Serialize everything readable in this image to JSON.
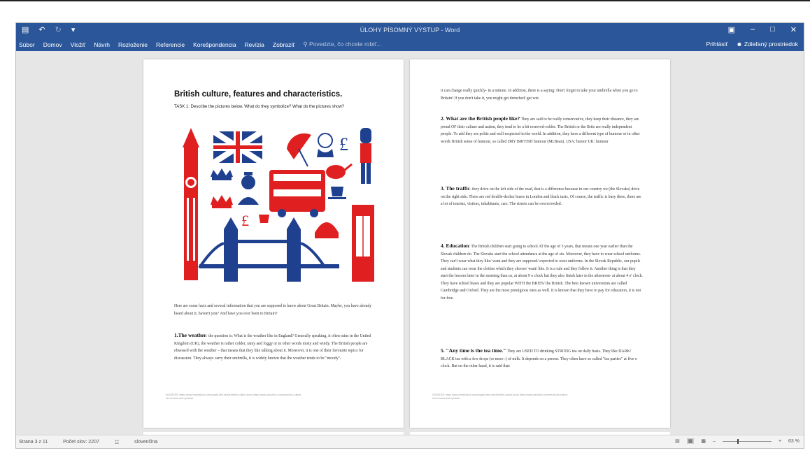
{
  "window": {
    "title": "ÚLOHY PÍSOMNÝ VÝSTUP - Word",
    "accent": "#2b579a"
  },
  "ribbon": {
    "tabs": [
      "Súbor",
      "Domov",
      "Vložiť",
      "Návrh",
      "Rozloženie",
      "Referencie",
      "Korešpondencia",
      "Revízia",
      "Zobraziť"
    ],
    "tell_me": "Povedzte, čo chcete robiť...",
    "sign_in": "Prihlásiť",
    "share": "Zdieľaný prostriedok"
  },
  "page1": {
    "title": "British culture, features and characteristics.",
    "task": "TASK 1: Describe the pictures below. What do they symbolize? What do the pictures show?",
    "intro": "Here are some facts and several information that you are supposed to know about Great Britain. Maybe, you have already heard about it, haven't you? And have you ever been to Britain?",
    "weather_head": "1.The weather",
    "weather_body": ": the question is: What is the weather like in England? Generally speaking, it often rains in the United Kingdom (UK), the weather is rather colder, rainy and foggy or in other words misty and windy. The British people are obsessed with the weather – that means that they like talking about it. Moreover, it is one of their favourite topics for discussion. They always carry their umbrella, it is widely known that the weather tends to be \"moody\"-",
    "sources": "SOURCES: https://www.vectorstock.com/royalty-free-vector/british-culture-icons https://www.colourbox.com/vector/uk-culture-set-of-icons-and-symbols"
  },
  "page2": {
    "p0": "it can change really quickly- in a minute. In addition, there is a saying: Don't forget to take your umbrella when you go to Britain! If you don't take it, you might get drenched/ get wet.",
    "p1_head": "2. What are the British people like?",
    "p1_body": " They are said to be really conservative, they keep their distance, they are proud OF their culture and nation, they tend to be a bit reserved-colder. The British or the Brits are really independent people. To add they are polite and well-respected in the world. In addition, they have a different type of humour or in other words British sense of humour, so called DRY BRITISH humour (Mr.Bean). USA: humor UK: humour",
    "p2_head": "3. The traffic",
    "p2_body": "- they drive on the left side of the road, that is a difference because in our country we (the Slovaks) drive on the right side. There are red double-decker buses in London and black taxis. Of course, the traffic is busy there, there are a lot of tourists, visitors, inhabitants, cars. The streets can be overcrowded.",
    "p3_head": "4. Education",
    "p3_body": ": The British children start going to school AT the age of 5 years, that means one year earlier than the Slovak children do. The Slovaks start the school attendance at the age of six. Moreover, they have to wear school uniforms. They can't wear what they like/ want and they are supposed/ expected to wear uniforms. In the Slovak Republic, our pupils and students can wear the clothes which they choose/ want/ like. It is a rule and they follow it. Another thing is that they start the lessons later in the morning than us, at about 9 o clock but they also finish later in the afternoon- at about 4 o' clock. They have school buses and they are popular WITH the BRITS/ the British. The best known universities are called Cambridge and Oxford. They are the most prestigious ones as well. It is known that they have to pay for education, it is not for free.",
    "p4_head": "5. \"Any time is the tea time.\"",
    "p4_body": " They are USED TO drinking STRONG tea on daily basis. They like DARK/ BLACK tea with a few drops (or more :) of milk. It depends on a person. They often have so called \"tea parties\" at five o clock. But on the other hand, it is said that:",
    "sources": "SOURCES: https://www.vectorstock.com/royalty-free-vector/british-culture-icons https://www.colourbox.com/vector/uk-culture-set-of-icons-and-symbols"
  },
  "status": {
    "page": "Strana 3 z 11",
    "words": "Počet slov: 2207",
    "language": "slovenčina",
    "zoom": "63 %",
    "zoom_fraction": 0.63
  }
}
